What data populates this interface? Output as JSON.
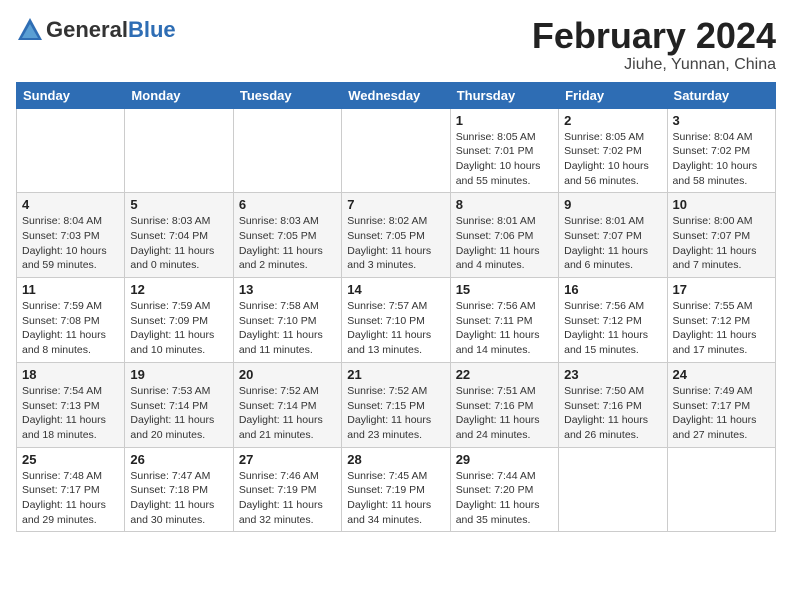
{
  "header": {
    "logo_general": "General",
    "logo_blue": "Blue",
    "month_title": "February 2024",
    "location": "Jiuhe, Yunnan, China"
  },
  "days_of_week": [
    "Sunday",
    "Monday",
    "Tuesday",
    "Wednesday",
    "Thursday",
    "Friday",
    "Saturday"
  ],
  "weeks": [
    [
      {
        "day": "",
        "info": ""
      },
      {
        "day": "",
        "info": ""
      },
      {
        "day": "",
        "info": ""
      },
      {
        "day": "",
        "info": ""
      },
      {
        "day": "1",
        "info": "Sunrise: 8:05 AM\nSunset: 7:01 PM\nDaylight: 10 hours and 55 minutes."
      },
      {
        "day": "2",
        "info": "Sunrise: 8:05 AM\nSunset: 7:02 PM\nDaylight: 10 hours and 56 minutes."
      },
      {
        "day": "3",
        "info": "Sunrise: 8:04 AM\nSunset: 7:02 PM\nDaylight: 10 hours and 58 minutes."
      }
    ],
    [
      {
        "day": "4",
        "info": "Sunrise: 8:04 AM\nSunset: 7:03 PM\nDaylight: 10 hours and 59 minutes."
      },
      {
        "day": "5",
        "info": "Sunrise: 8:03 AM\nSunset: 7:04 PM\nDaylight: 11 hours and 0 minutes."
      },
      {
        "day": "6",
        "info": "Sunrise: 8:03 AM\nSunset: 7:05 PM\nDaylight: 11 hours and 2 minutes."
      },
      {
        "day": "7",
        "info": "Sunrise: 8:02 AM\nSunset: 7:05 PM\nDaylight: 11 hours and 3 minutes."
      },
      {
        "day": "8",
        "info": "Sunrise: 8:01 AM\nSunset: 7:06 PM\nDaylight: 11 hours and 4 minutes."
      },
      {
        "day": "9",
        "info": "Sunrise: 8:01 AM\nSunset: 7:07 PM\nDaylight: 11 hours and 6 minutes."
      },
      {
        "day": "10",
        "info": "Sunrise: 8:00 AM\nSunset: 7:07 PM\nDaylight: 11 hours and 7 minutes."
      }
    ],
    [
      {
        "day": "11",
        "info": "Sunrise: 7:59 AM\nSunset: 7:08 PM\nDaylight: 11 hours and 8 minutes."
      },
      {
        "day": "12",
        "info": "Sunrise: 7:59 AM\nSunset: 7:09 PM\nDaylight: 11 hours and 10 minutes."
      },
      {
        "day": "13",
        "info": "Sunrise: 7:58 AM\nSunset: 7:10 PM\nDaylight: 11 hours and 11 minutes."
      },
      {
        "day": "14",
        "info": "Sunrise: 7:57 AM\nSunset: 7:10 PM\nDaylight: 11 hours and 13 minutes."
      },
      {
        "day": "15",
        "info": "Sunrise: 7:56 AM\nSunset: 7:11 PM\nDaylight: 11 hours and 14 minutes."
      },
      {
        "day": "16",
        "info": "Sunrise: 7:56 AM\nSunset: 7:12 PM\nDaylight: 11 hours and 15 minutes."
      },
      {
        "day": "17",
        "info": "Sunrise: 7:55 AM\nSunset: 7:12 PM\nDaylight: 11 hours and 17 minutes."
      }
    ],
    [
      {
        "day": "18",
        "info": "Sunrise: 7:54 AM\nSunset: 7:13 PM\nDaylight: 11 hours and 18 minutes."
      },
      {
        "day": "19",
        "info": "Sunrise: 7:53 AM\nSunset: 7:14 PM\nDaylight: 11 hours and 20 minutes."
      },
      {
        "day": "20",
        "info": "Sunrise: 7:52 AM\nSunset: 7:14 PM\nDaylight: 11 hours and 21 minutes."
      },
      {
        "day": "21",
        "info": "Sunrise: 7:52 AM\nSunset: 7:15 PM\nDaylight: 11 hours and 23 minutes."
      },
      {
        "day": "22",
        "info": "Sunrise: 7:51 AM\nSunset: 7:16 PM\nDaylight: 11 hours and 24 minutes."
      },
      {
        "day": "23",
        "info": "Sunrise: 7:50 AM\nSunset: 7:16 PM\nDaylight: 11 hours and 26 minutes."
      },
      {
        "day": "24",
        "info": "Sunrise: 7:49 AM\nSunset: 7:17 PM\nDaylight: 11 hours and 27 minutes."
      }
    ],
    [
      {
        "day": "25",
        "info": "Sunrise: 7:48 AM\nSunset: 7:17 PM\nDaylight: 11 hours and 29 minutes."
      },
      {
        "day": "26",
        "info": "Sunrise: 7:47 AM\nSunset: 7:18 PM\nDaylight: 11 hours and 30 minutes."
      },
      {
        "day": "27",
        "info": "Sunrise: 7:46 AM\nSunset: 7:19 PM\nDaylight: 11 hours and 32 minutes."
      },
      {
        "day": "28",
        "info": "Sunrise: 7:45 AM\nSunset: 7:19 PM\nDaylight: 11 hours and 34 minutes."
      },
      {
        "day": "29",
        "info": "Sunrise: 7:44 AM\nSunset: 7:20 PM\nDaylight: 11 hours and 35 minutes."
      },
      {
        "day": "",
        "info": ""
      },
      {
        "day": "",
        "info": ""
      }
    ]
  ]
}
